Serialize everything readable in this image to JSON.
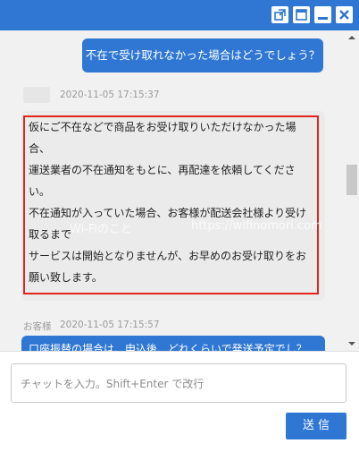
{
  "window": {
    "buttons": [
      "popout-icon",
      "window-icon",
      "minimize-icon",
      "close-icon"
    ]
  },
  "messages": {
    "user_question": "不在で受け取れなかった場合はどうでしょう？",
    "bot_timestamp": "2020-11-05 17:15:37",
    "bot_lines": [
      "仮にご不在などで商品をお受け取りいただけなかった場",
      "合、",
      "運送業者の不在通知をもとに、再配達を依頼してくださ",
      "い。",
      "不在通知が入っていた場合、お客様が配送会社様より受け",
      "取るまで",
      "サービスは開始となりませんが、お早めのお受け取りをお",
      "願い致します。"
    ],
    "customer_label": "お客様",
    "customer_timestamp": "2020-11-05 17:15:57",
    "partial_message": "口座振替の場合は、申込後、どれくらいで発送予定でし？"
  },
  "watermark": {
    "left": "Wi-Fiのこと",
    "right": "https://wifinomori.com"
  },
  "composer": {
    "placeholder": "チャットを入力。Shift+Enter で改行",
    "send_label": "送 信"
  },
  "colors": {
    "primary": "#2f77d3",
    "highlight_border": "#e1251b",
    "chat_bg": "#f1f1f1",
    "bot_bubble": "#ebebeb"
  }
}
